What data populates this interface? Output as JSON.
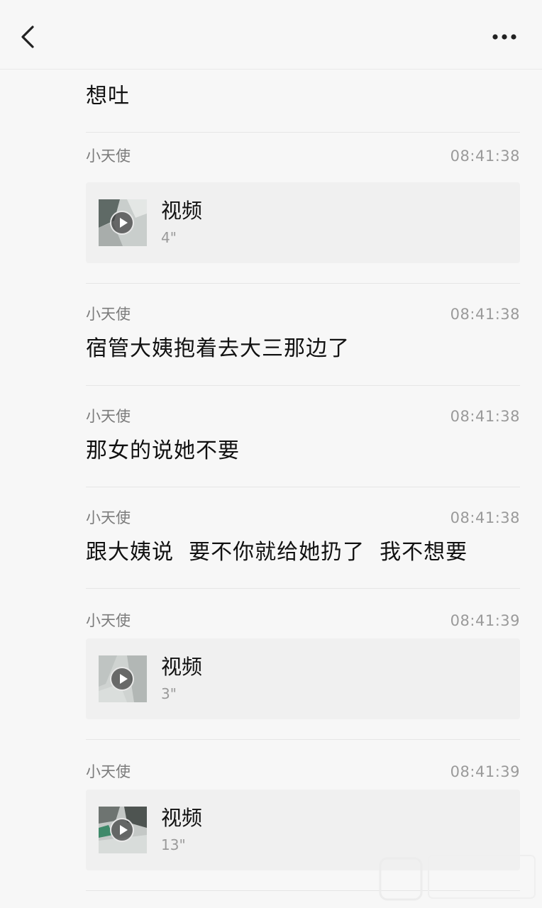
{
  "header": {
    "back_icon": "chevron-left-icon",
    "more_icon": "more-horizontal-icon"
  },
  "first_message": {
    "text": "想吐"
  },
  "records": [
    {
      "sender": "小天使",
      "time": "08:41:38",
      "type": "video",
      "video_label": "视频",
      "duration": "4\""
    },
    {
      "sender": "小天使",
      "time": "08:41:38",
      "type": "text",
      "text": "宿管大姨抱着去大三那边了"
    },
    {
      "sender": "小天使",
      "time": "08:41:38",
      "type": "text",
      "text": "那女的说她不要"
    },
    {
      "sender": "小天使",
      "time": "08:41:38",
      "type": "text",
      "text": "跟大姨说  要不你就给她扔了  我不想要"
    },
    {
      "sender": "小天使",
      "time": "08:41:39",
      "type": "video",
      "video_label": "视频",
      "duration": "3\""
    },
    {
      "sender": "小天使",
      "time": "08:41:39",
      "type": "video",
      "video_label": "视频",
      "duration": "13\""
    }
  ],
  "colors": {
    "background": "#f7f7f7",
    "card": "#f0f0f0",
    "meta_text": "#9a9a9a",
    "divider": "#e6e6e6"
  }
}
